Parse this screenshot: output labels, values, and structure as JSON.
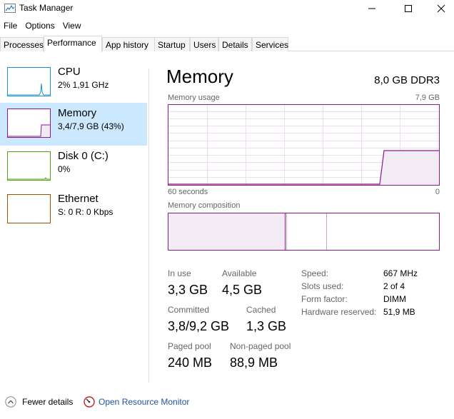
{
  "window": {
    "title": "Task Manager"
  },
  "menu": [
    "File",
    "Options",
    "View"
  ],
  "tabs": [
    "Processes",
    "Performance",
    "App history",
    "Startup",
    "Users",
    "Details",
    "Services"
  ],
  "active_tab": "Performance",
  "sidebar": {
    "items": [
      {
        "name": "CPU",
        "sub": "2% 1,91 GHz",
        "color": "#1790d4"
      },
      {
        "name": "Memory",
        "sub": "3,4/7,9 GB (43%)",
        "color": "#8b1a8f"
      },
      {
        "name": "Disk 0 (C:)",
        "sub": "0%",
        "color": "#4da60c"
      },
      {
        "name": "Ethernet",
        "sub": "S: 0 R: 0 Kbps",
        "color": "#a74f01"
      }
    ]
  },
  "memory": {
    "title": "Memory",
    "spec": "8,0 GB DDR3",
    "usage_label": "Memory usage",
    "usage_max": "7,9 GB",
    "time_label": "60 seconds",
    "time_zero": "0",
    "composition_label": "Memory composition",
    "stats": {
      "in_use_label": "In use",
      "in_use": "3,3 GB",
      "available_label": "Available",
      "available": "4,5 GB",
      "committed_label": "Committed",
      "committed": "3,8/9,2 GB",
      "cached_label": "Cached",
      "cached": "1,3 GB",
      "paged_label": "Paged pool",
      "paged": "240 MB",
      "nonpaged_label": "Non-paged pool",
      "nonpaged": "88,9 MB"
    },
    "specs": {
      "speed_label": "Speed:",
      "speed": "667 MHz",
      "slots_label": "Slots used:",
      "slots": "2 of 4",
      "form_label": "Form factor:",
      "form": "DIMM",
      "reserved_label": "Hardware reserved:",
      "reserved": "51,9 MB"
    }
  },
  "footer": {
    "fewer_details": "Fewer details",
    "resource_monitor": "Open Resource Monitor"
  },
  "colors": {
    "memory_accent": "#8b1a8f",
    "selection": "#cce8ff",
    "link": "#1b56a5"
  },
  "icons": [
    "task-manager-icon",
    "minimize-icon",
    "maximize-icon",
    "close-icon",
    "chevron-up-icon",
    "resource-monitor-icon"
  ]
}
